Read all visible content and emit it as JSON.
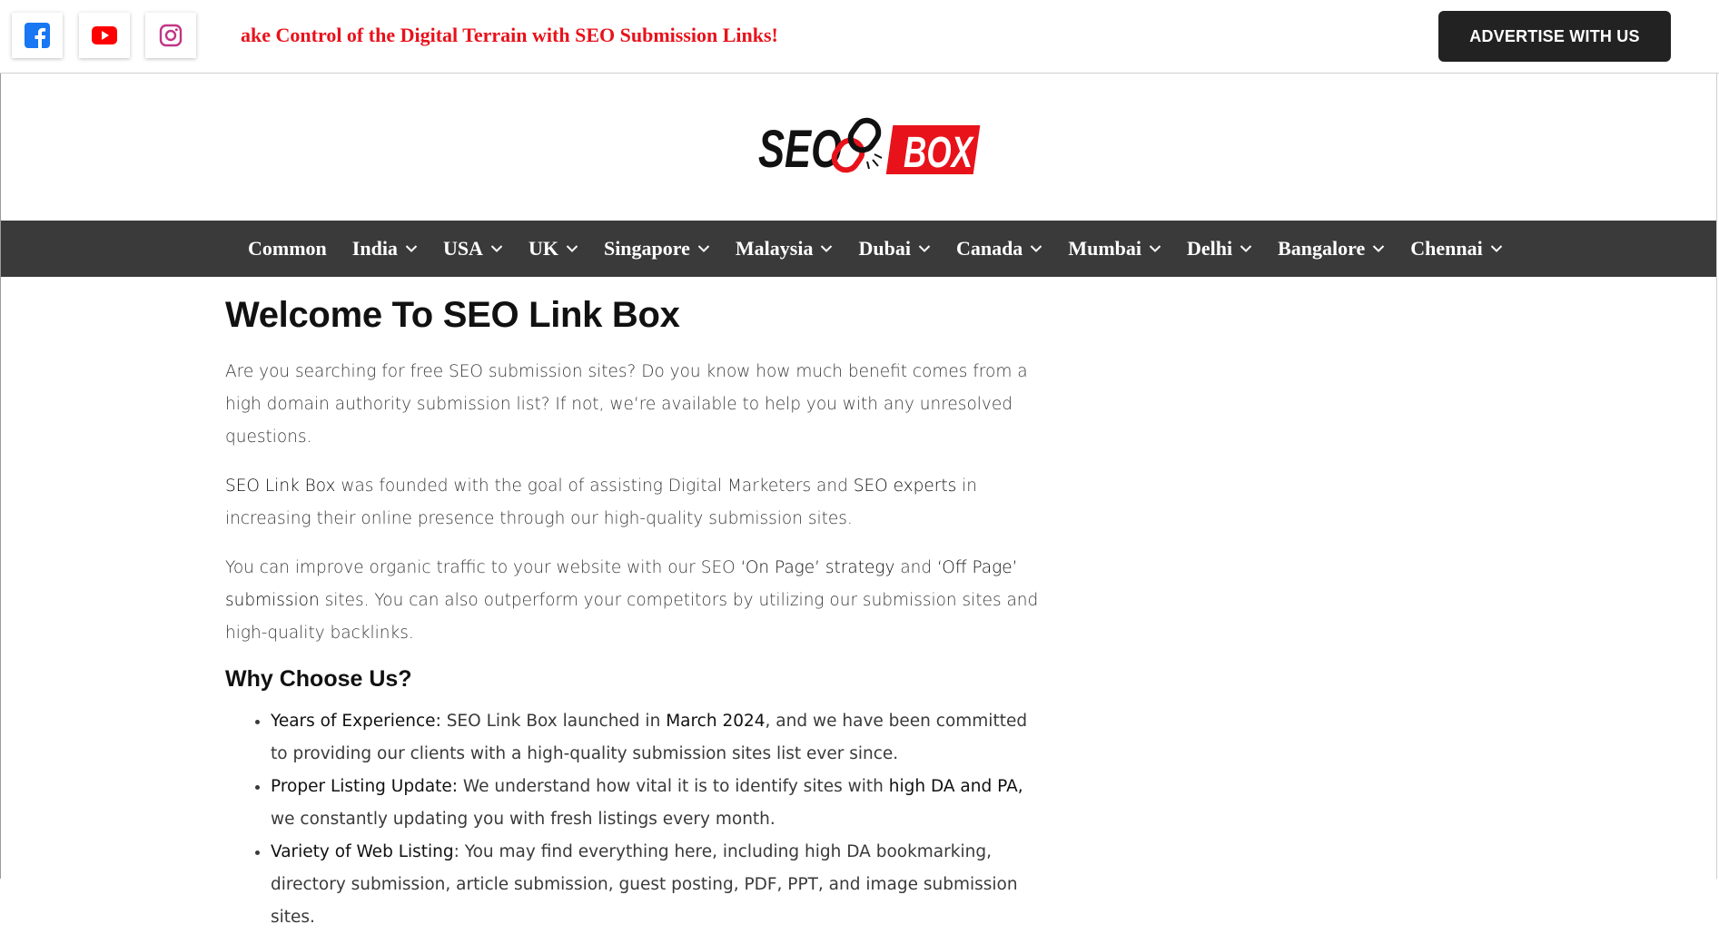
{
  "topbar": {
    "social": [
      {
        "name": "facebook-icon",
        "color": "#1877f2"
      },
      {
        "name": "youtube-icon",
        "color": "#ff0000"
      },
      {
        "name": "instagram-icon",
        "color": "#c13584"
      }
    ],
    "ticker_text": "ake Control of the Digital Terrain with SEO Submission Links!",
    "advertise_label": "ADVERTISE WITH US"
  },
  "logo": {
    "left_text": "SEO",
    "right_text": "BOX",
    "accent": "#e8121b"
  },
  "nav": {
    "items": [
      {
        "label": "Common",
        "dropdown": false
      },
      {
        "label": "India",
        "dropdown": true
      },
      {
        "label": "USA",
        "dropdown": true
      },
      {
        "label": "UK",
        "dropdown": true
      },
      {
        "label": "Singapore",
        "dropdown": true
      },
      {
        "label": "Malaysia",
        "dropdown": true
      },
      {
        "label": "Dubai",
        "dropdown": true
      },
      {
        "label": "Canada",
        "dropdown": true
      },
      {
        "label": "Mumbai",
        "dropdown": true
      },
      {
        "label": "Delhi",
        "dropdown": true
      },
      {
        "label": "Bangalore",
        "dropdown": true
      },
      {
        "label": "Chennai",
        "dropdown": true
      }
    ]
  },
  "main": {
    "title": "Welcome To SEO Link Box",
    "p1": "Are you searching for free SEO submission sites? Do you know how much benefit comes from a high domain authority submission list? If not, we’re available to help you with any unresolved questions.",
    "p2": {
      "link1": "SEO Link Box",
      "text1": " was founded with the goal of assisting Digital Marketers and ",
      "link2": "SEO experts",
      "text2": " in increasing their online presence through our high-quality submission sites."
    },
    "p3": {
      "text1": "You can improve organic traffic to your website with our SEO ",
      "link1": "‘On Page’ strategy",
      "text2": " and ",
      "link2": "‘Off Page’ submission",
      "text3": " sites. You can also outperform your competitors by utilizing our submission sites and high-quality backlinks."
    },
    "why_heading": "Why Choose Us?",
    "bullets": [
      {
        "lead": "Years of Experience:",
        "text1": " SEO Link Box launched in ",
        "strong": "March 2024",
        "text2": ", and we have been committed to providing our clients with a high-quality submission sites list ever since."
      },
      {
        "lead": "Proper Listing Update:",
        "text1": " We understand how vital it is to identify sites with ",
        "strong": "high DA and PA,",
        "text2": "  we constantly updating you with fresh listings every month."
      },
      {
        "lead": "Variety of Web Listing",
        "text1": ": You may find everything here, including high DA bookmarking, directory submission, article submission, guest posting, PDF, PPT, and image submission sites.",
        "strong": "",
        "text2": ""
      }
    ]
  }
}
